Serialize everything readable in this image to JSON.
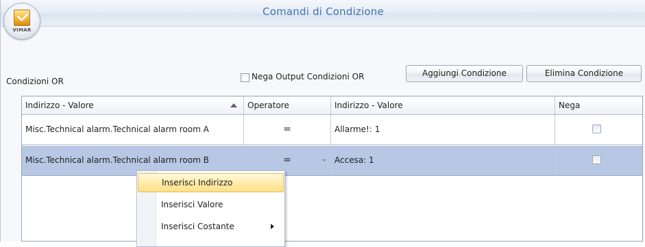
{
  "window": {
    "title": "Comandi di Condizione",
    "logo_text": "VIMAR"
  },
  "toolbar": {
    "or_label": "Condizioni OR",
    "negate_output_label": "Nega Output Condizioni OR",
    "negate_output_checked": false,
    "add_button": "Aggiungi Condizione",
    "delete_button": "Elimina Condizione"
  },
  "grid": {
    "columns": [
      "Indirizzo - Valore",
      "Operatore",
      "Indirizzo - Valore",
      "Nega"
    ],
    "sort_column": "Indirizzo - Valore",
    "sort_direction": "ascending",
    "rows": [
      {
        "address": "Misc.Technical alarm.Technical alarm room A",
        "operator": "=",
        "value": "Allarme!: 1",
        "negate": false,
        "selected": false
      },
      {
        "address": "Misc.Technical alarm.Technical alarm room B",
        "operator": "=",
        "value": "Accesa: 1",
        "negate": false,
        "selected": true
      }
    ]
  },
  "context_menu": {
    "items": [
      {
        "label": "Inserisci Indirizzo",
        "highlighted": true,
        "submenu": false
      },
      {
        "label": "Inserisci Valore",
        "highlighted": false,
        "submenu": false
      },
      {
        "label": "Inserisci Costante",
        "highlighted": false,
        "submenu": true
      }
    ]
  },
  "colors": {
    "title_text": "#4373ad",
    "selected_row": "#b7c7e4",
    "menu_highlight": "#ffe9a3"
  }
}
